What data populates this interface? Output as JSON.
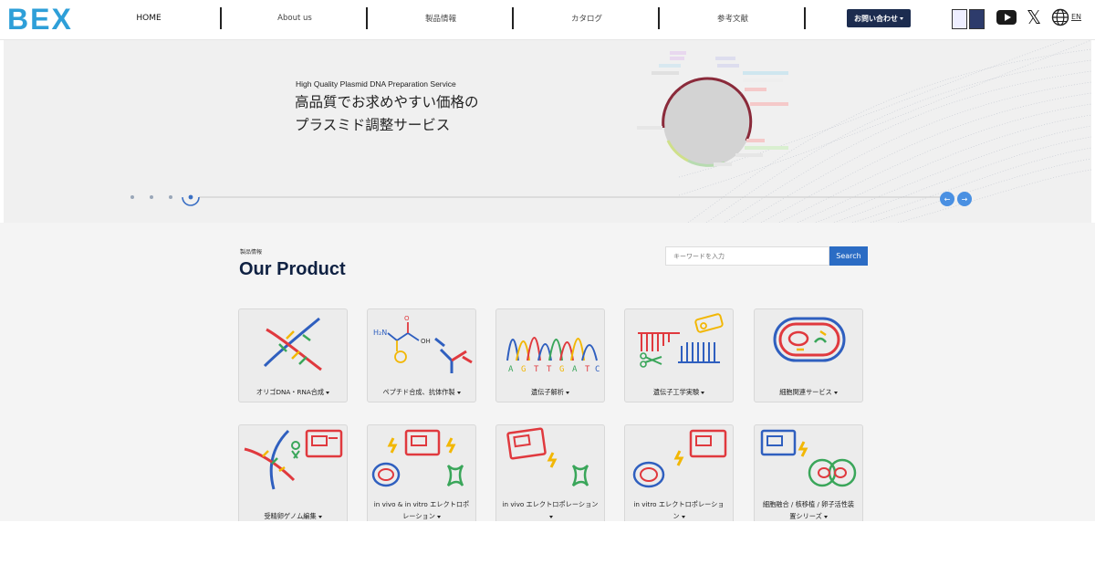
{
  "header": {
    "logo": "BEX",
    "nav": [
      {
        "label": "HOME"
      },
      {
        "label": "About us"
      },
      {
        "label": "製品情報"
      },
      {
        "label": "カタログ"
      },
      {
        "label": "参考文献"
      }
    ],
    "contact_label": "お問い合わせ",
    "lang_label": "EN"
  },
  "hero": {
    "subtitle": "High Quality Plasmid DNA Preparation Service",
    "title_line1": "高品質でお求めやすい価格の",
    "title_line2": "プラスミド調整サービス",
    "prev_label": "←",
    "next_label": "→"
  },
  "products": {
    "section_label": "製品情報",
    "title": "Our Product",
    "search_placeholder": "キーワードを入力",
    "search_button": "Search",
    "cards": [
      {
        "label": "オリゴDNA・RNA合成",
        "icon": "dna-helix-icon"
      },
      {
        "label": "ペプチド合成、抗体作製",
        "icon": "peptide-antibody-icon"
      },
      {
        "label": "遺伝子解析",
        "icon": "sequencing-chromatogram-icon"
      },
      {
        "label": "遺伝子工学実験",
        "icon": "gene-engineering-icon"
      },
      {
        "label": "細胞関連サービス",
        "icon": "cell-icon"
      },
      {
        "label": "受精卵ゲノム編集",
        "icon": "genome-editing-icon"
      },
      {
        "label": "in vivo & in vitro エレクトロポレーション",
        "icon": "electroporation-icon"
      },
      {
        "label": "in vivo エレクトロポレーション",
        "icon": "in-vivo-electroporation-icon"
      },
      {
        "label": "in vitro エレクトロポレーション",
        "icon": "in-vitro-electroporation-icon"
      },
      {
        "label": "細胞融合 / 核移植 / 卵子活性装置シリーズ",
        "icon": "cell-fusion-icon"
      }
    ]
  },
  "colors": {
    "brand": "#2e9fd8",
    "navy": "#1c2c4f",
    "accent_blue": "#2b6cc4",
    "dna_red": "#e0393e",
    "dna_blue": "#2f5fbf",
    "dna_yellow": "#f2b705",
    "dna_green": "#3aa65a"
  }
}
